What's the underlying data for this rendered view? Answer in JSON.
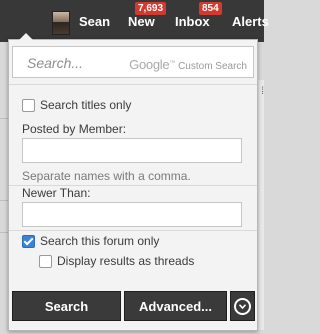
{
  "nav": {
    "user_name": "Sean",
    "new_label": "New",
    "new_count": "7,693",
    "inbox_label": "Inbox",
    "inbox_count": "854",
    "alerts_label": "Alerts"
  },
  "search": {
    "placeholder": "Search...",
    "google_brand": "Google",
    "custom_search": "Custom Search"
  },
  "options": {
    "titles_only_label": "Search titles only",
    "titles_only_checked": false,
    "posted_by_label": "Posted by Member:",
    "posted_by_value": "",
    "posted_by_hint": "Separate names with a comma.",
    "newer_than_label": "Newer Than:",
    "newer_than_value": "",
    "this_forum_label": "Search this forum only",
    "this_forum_checked": true,
    "as_threads_label": "Display results as threads",
    "as_threads_checked": false
  },
  "buttons": {
    "search_label": "Search",
    "advanced_label": "Advanced...",
    "more_icon": "chevron-down-circle-icon"
  },
  "colors": {
    "topbar": "#383838",
    "badge": "#d33a2f",
    "checkbox_checked": "#3b82d6",
    "button": "#3a3a3a"
  }
}
